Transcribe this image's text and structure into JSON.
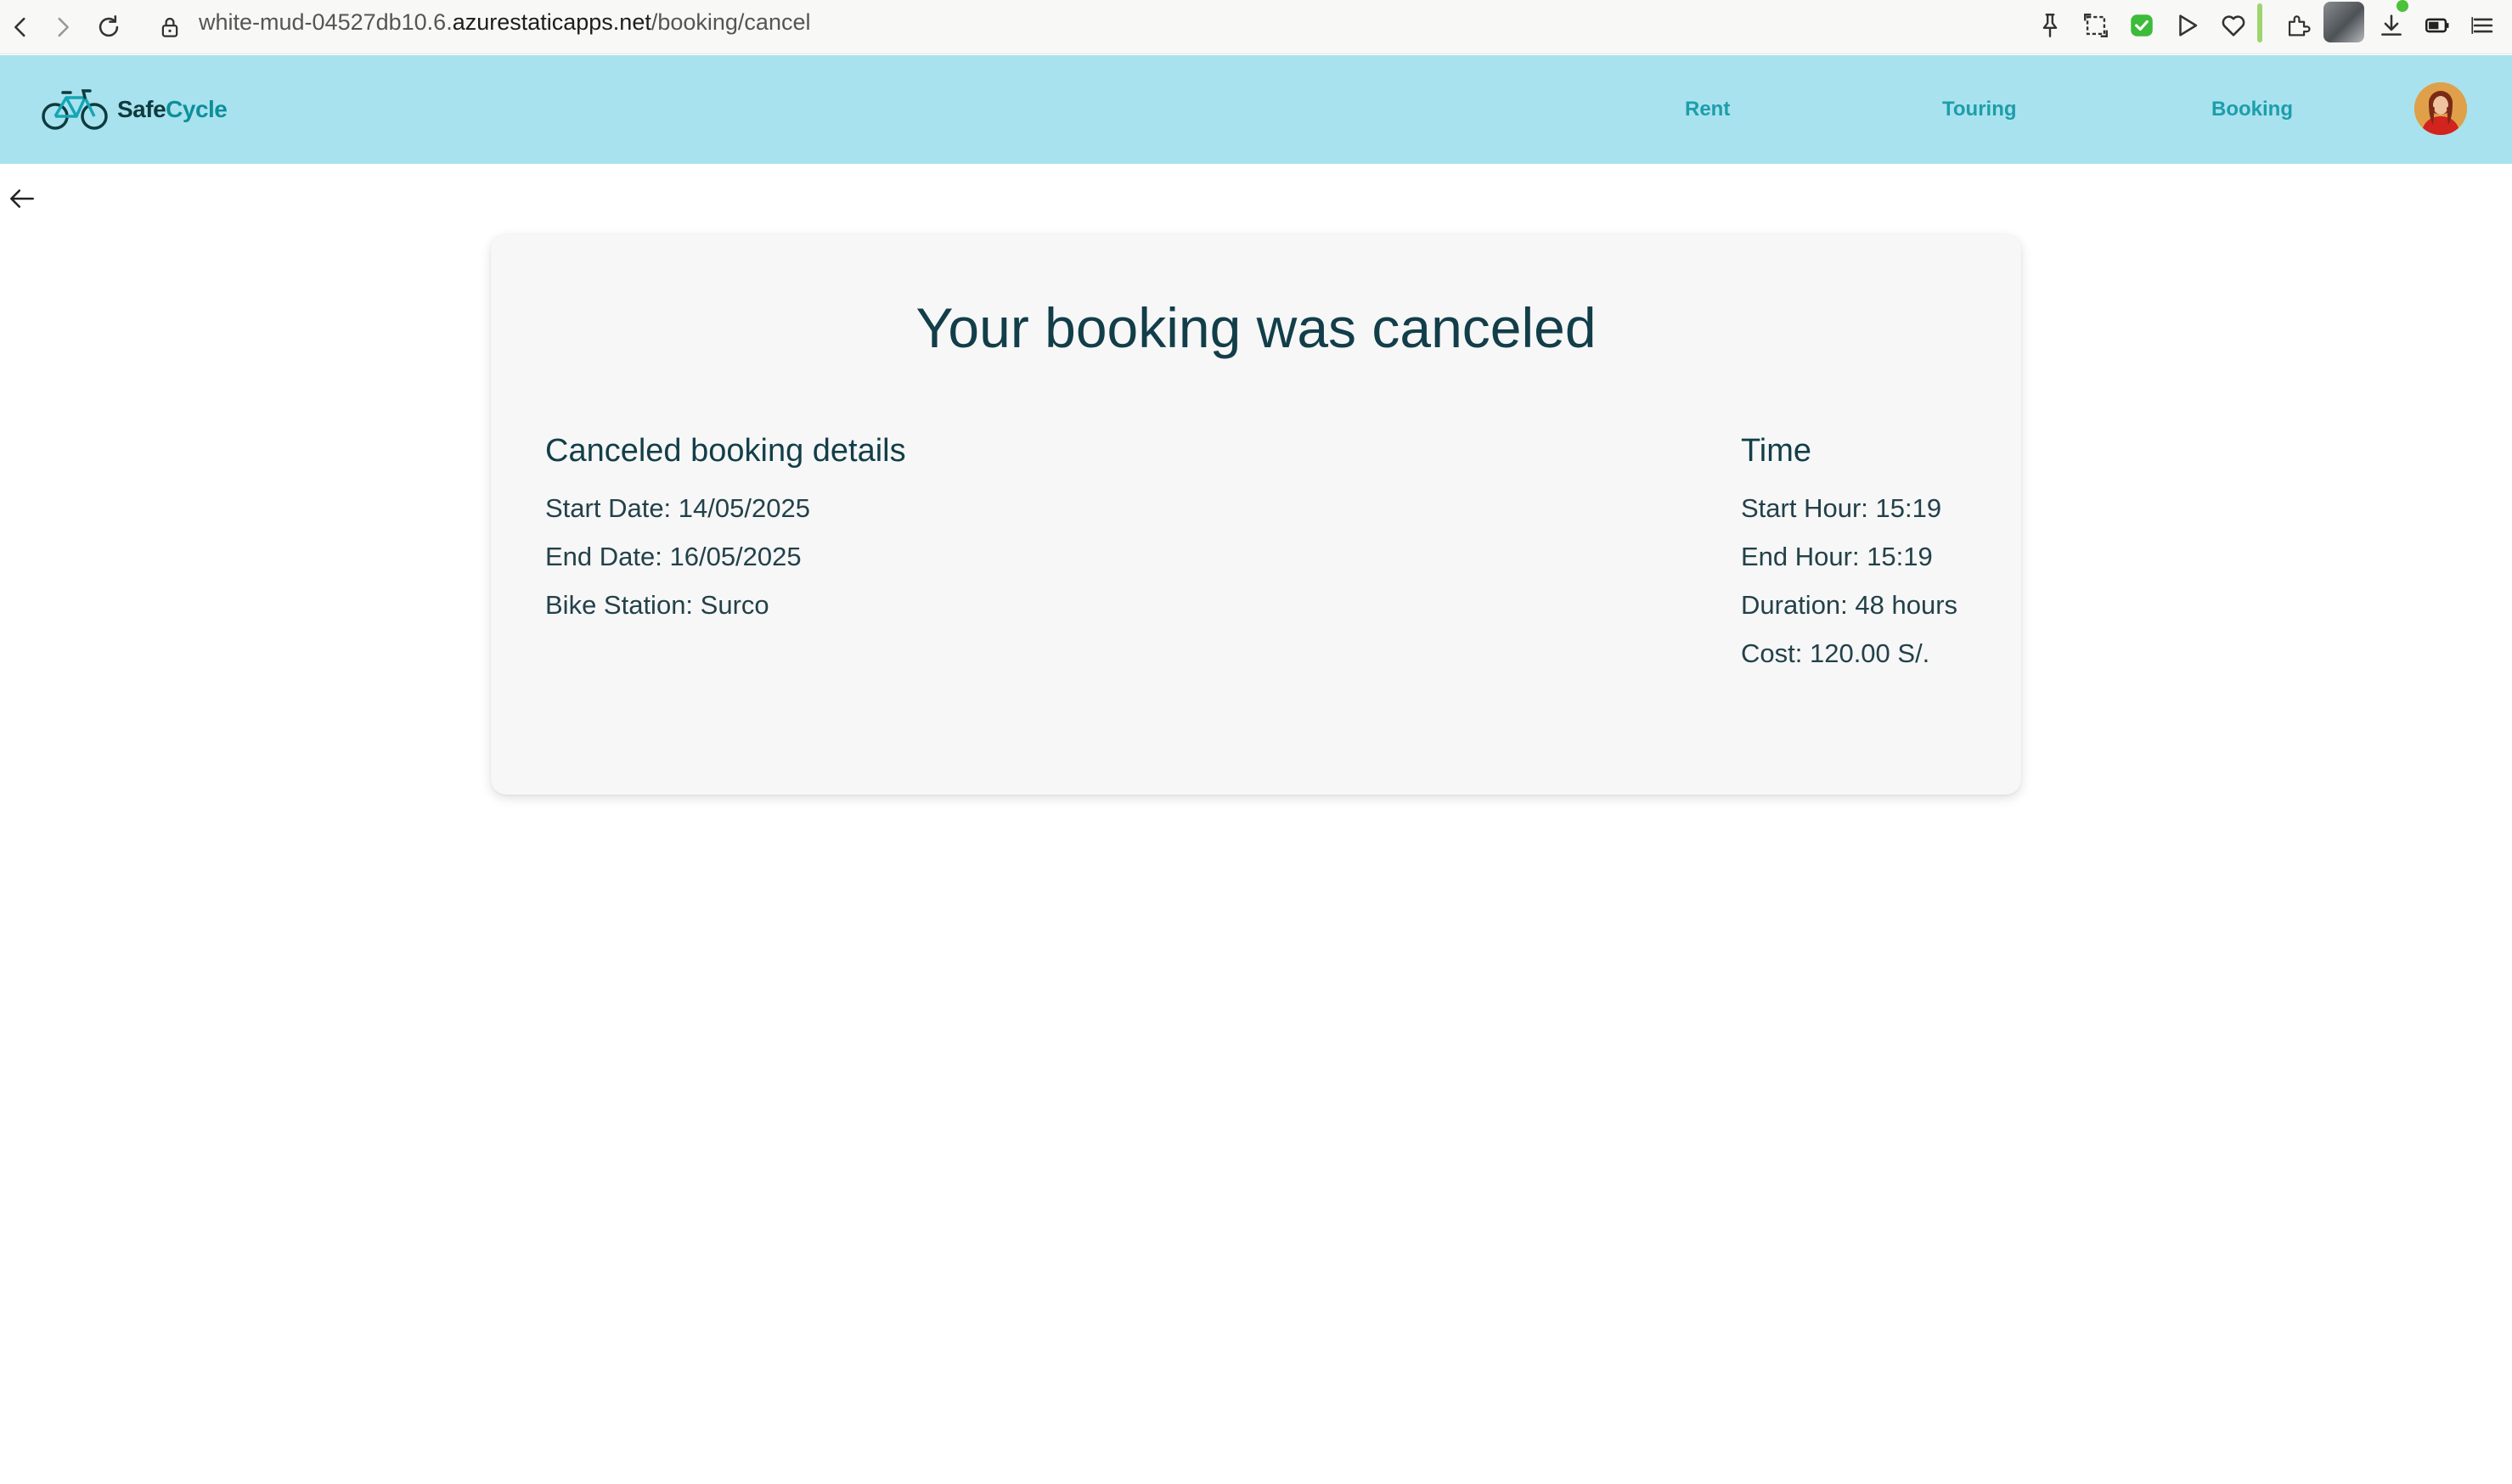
{
  "browser": {
    "url_prefix": "white-mud-04527db10.6.",
    "url_host": "azurestaticapps.net",
    "url_path": "/booking/cancel"
  },
  "header": {
    "logo_text_primary": "Safe",
    "logo_text_accent": "Cycle",
    "nav": [
      {
        "label": "Rent"
      },
      {
        "label": "Touring"
      },
      {
        "label": "Booking"
      }
    ]
  },
  "card": {
    "title": "Your booking was canceled",
    "details_heading": "Canceled booking details",
    "details": [
      {
        "text": "Start Date: 14/05/2025"
      },
      {
        "text": "End Date: 16/05/2025"
      },
      {
        "text": "Bike Station: Surco"
      }
    ],
    "time_heading": "Time",
    "time": [
      {
        "text": "Start Hour: 15:19"
      },
      {
        "text": "End Hour: 15:19"
      },
      {
        "text": "Duration: 48 hours"
      },
      {
        "text": "Cost: 120.00 S/."
      }
    ]
  },
  "colors": {
    "header_bg": "#a8e2ee",
    "nav_link": "#1c9eaa",
    "title": "#123e49",
    "card_bg": "#f7f7f7"
  },
  "icons": [
    "back-icon",
    "forward-icon",
    "reload-icon",
    "lock-icon",
    "pin-icon",
    "screenshot-icon",
    "shield-check-icon",
    "play-icon",
    "heart-icon",
    "extensions-icon",
    "download-icon",
    "battery-icon",
    "menu-icon",
    "bicycle-logo-icon",
    "arrow-left-icon"
  ]
}
